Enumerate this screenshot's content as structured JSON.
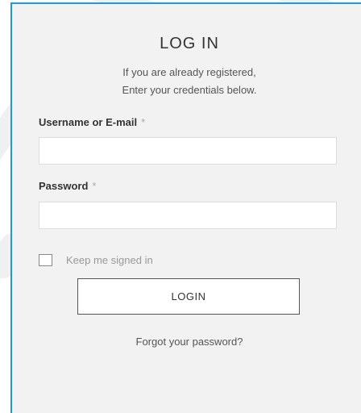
{
  "form": {
    "title": "LOG IN",
    "subtitle_line1": "If you are already registered,",
    "subtitle_line2": "Enter your credentials below.",
    "username_label": "Username or E-mail",
    "username_required_mark": "*",
    "username_value": "",
    "password_label": "Password",
    "password_required_mark": "*",
    "password_value": "",
    "keep_signed_in_label": "Keep me signed in",
    "keep_signed_in_checked": false,
    "login_button_label": "LOGIN",
    "forgot_password_link": "Forgot your password?"
  },
  "colors": {
    "panel_border": "#1d9bd7",
    "panel_background": "#f2f2f2"
  }
}
